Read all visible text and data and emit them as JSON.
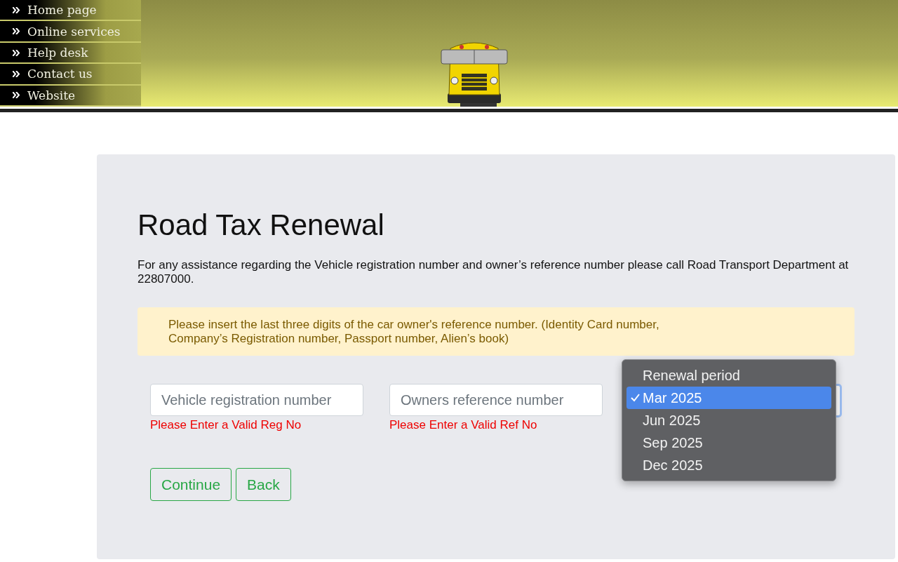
{
  "nav": [
    {
      "label": "Home page"
    },
    {
      "label": "Online services"
    },
    {
      "label": "Help desk"
    },
    {
      "label": "Contact us"
    },
    {
      "label": "Website"
    }
  ],
  "title": "Road Tax Renewal",
  "intro": "For any assistance regarding the Vehicle registration number and owner’s reference number please call Road Transport Department at 22807000.",
  "notice": "Please insert the last three digits of the car owner's reference number. (Identity Card number, Company’s Registration number, Passport number, Alien’s book)",
  "fields": [
    {
      "placeholder": "Vehicle registration number",
      "error": "Please Enter a Valid Reg No"
    },
    {
      "placeholder": "Owners reference number",
      "error": "Please Enter a Valid Ref No"
    }
  ],
  "dropdown": {
    "expanded": true,
    "options": [
      {
        "label": "Renewal period",
        "selected": false
      },
      {
        "label": "Mar 2025",
        "selected": true
      },
      {
        "label": "Jun 2025",
        "selected": false
      },
      {
        "label": "Sep 2025",
        "selected": false
      },
      {
        "label": "Dec 2025",
        "selected": false
      }
    ]
  },
  "buttons": [
    "Continue",
    "Back"
  ]
}
